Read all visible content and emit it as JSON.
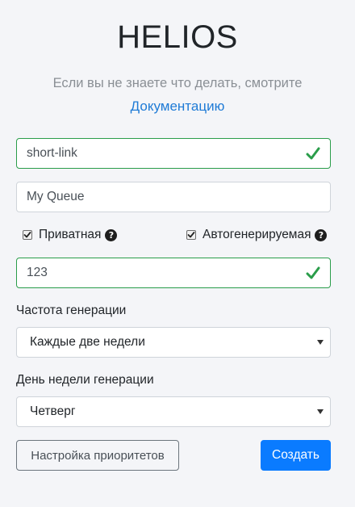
{
  "header": {
    "title": "HELIOS",
    "subtitle": "Если вы не знаете что делать, смотрите",
    "doc_link": "Документацию"
  },
  "form": {
    "link_field": {
      "value": "short-link",
      "status": "valid"
    },
    "queue_field": {
      "value": "My Queue"
    },
    "private_checkbox": {
      "label": "Приватная",
      "checked": true,
      "icon": "question-circle-icon"
    },
    "autogen_checkbox": {
      "label": "Автогенерируемая",
      "checked": true,
      "icon": "question-circle-icon"
    },
    "number_field": {
      "value": "123",
      "status": "valid"
    },
    "frequency": {
      "label": "Частота генерации",
      "selected": "Каждые две недели"
    },
    "weekday": {
      "label": "День недели генерации",
      "selected": "Четверг"
    }
  },
  "buttons": {
    "priorities": "Настройка приоритетов",
    "create": "Создать"
  },
  "colors": {
    "valid": "#2a9d4a",
    "primary": "#0a7bff",
    "link": "#1f7bd6",
    "background": "#f4f5f8"
  }
}
